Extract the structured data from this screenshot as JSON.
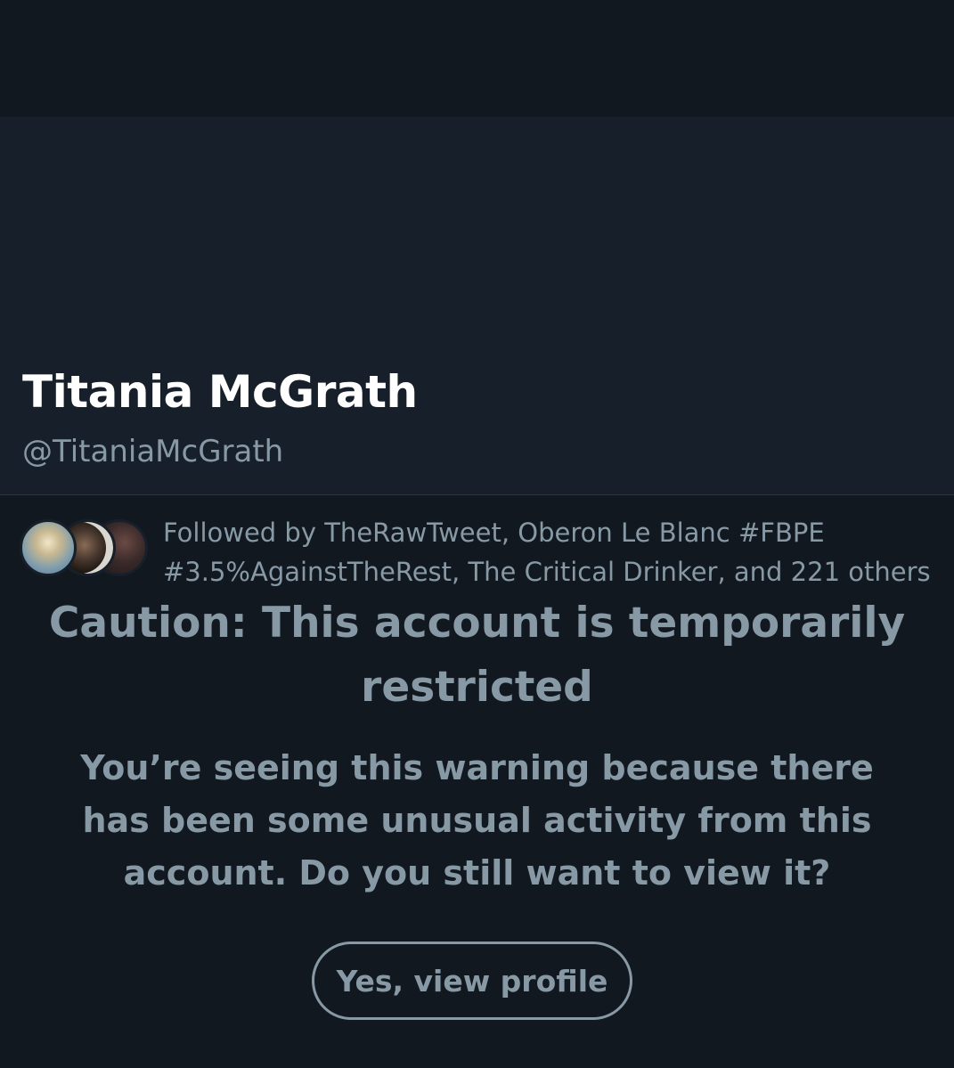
{
  "profile": {
    "display_name": "Titania McGrath",
    "handle": "@TitaniaMcGrath",
    "followed_by_text": "Followed by TheRawTweet, Oberon Le Blanc #FBPE #3.5%AgainstTheRest, The Critical Drinker, and 221 others"
  },
  "warning": {
    "title": "Caution: This account is temporarily restricted",
    "body": "You’re seeing this warning because there has been some unusual activity from this account. Do you still want to view it?",
    "button_label": "Yes, view profile"
  },
  "colors": {
    "background": "#121820",
    "card": "#17202a",
    "muted_text": "#8899a6",
    "name_text": "#ffffff"
  }
}
